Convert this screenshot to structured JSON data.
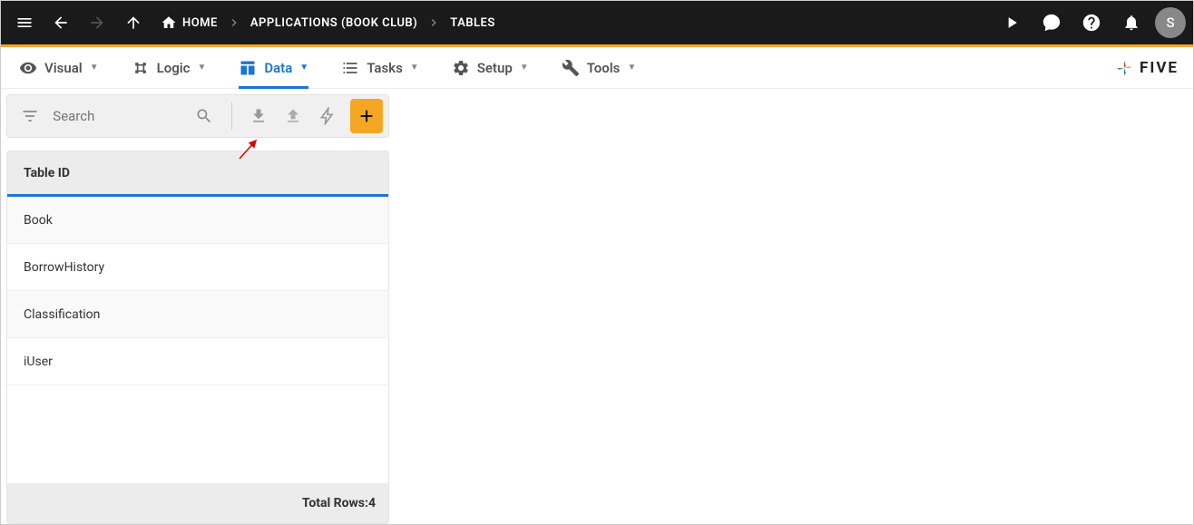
{
  "topbar": {
    "home_label": "HOME",
    "applications_label": "APPLICATIONS (BOOK CLUB)",
    "tables_label": "TABLES",
    "avatar_initial": "S"
  },
  "tabs": {
    "visual": "Visual",
    "logic": "Logic",
    "data": "Data",
    "tasks": "Tasks",
    "setup": "Setup",
    "tools": "Tools"
  },
  "logo": {
    "text": "FIVE"
  },
  "search": {
    "placeholder": "Search"
  },
  "table": {
    "header": "Table ID",
    "rows": [
      "Book",
      "BorrowHistory",
      "Classification",
      "iUser"
    ],
    "footer_label": "Total Rows: ",
    "footer_count": "4"
  }
}
